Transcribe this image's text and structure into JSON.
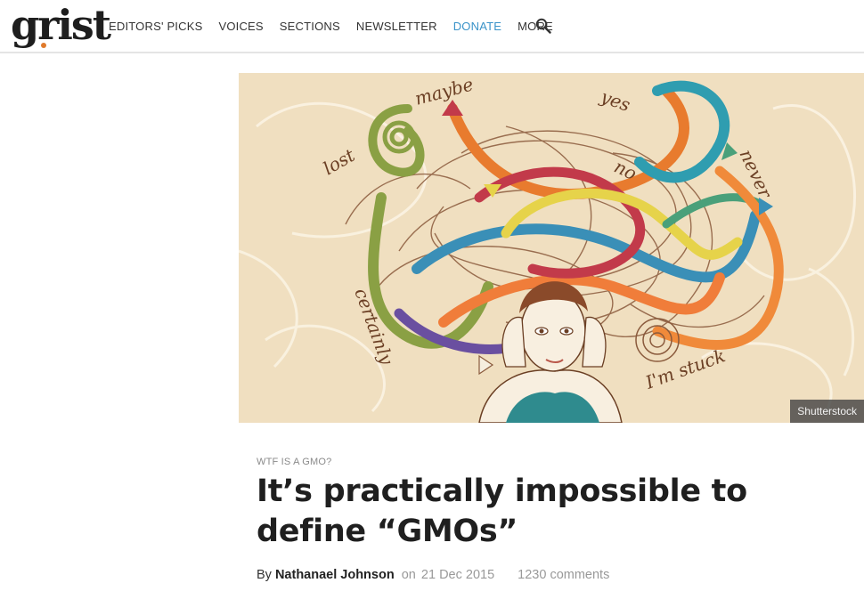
{
  "header": {
    "logo_text": "grist",
    "nav": [
      {
        "label": "EDITORS' PICKS"
      },
      {
        "label": "VOICES"
      },
      {
        "label": "SECTIONS"
      },
      {
        "label": "NEWSLETTER"
      },
      {
        "label": "DONATE"
      },
      {
        "label": "MORE"
      }
    ],
    "search_icon": "search-icon",
    "accent_color": "#3a93c9",
    "logo_dot_color": "#e07a2c"
  },
  "hero": {
    "credit": "Shutterstock",
    "words": [
      "maybe",
      "yes",
      "lost",
      "no",
      "never",
      "certainly",
      "I'm stuck"
    ]
  },
  "article": {
    "kicker": "WTF IS A GMO?",
    "title": "It’s practically impossible to define “GMOs”",
    "author_prefix": "By",
    "author": "Nathanael Johnson",
    "date_prefix": "on",
    "date": "21 Dec 2015",
    "comments": "1230 comments"
  }
}
